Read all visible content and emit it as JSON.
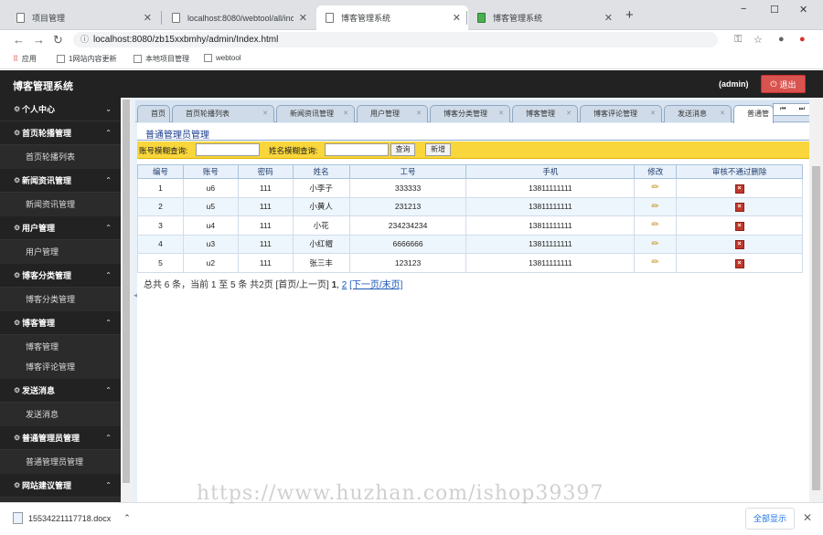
{
  "browser": {
    "tabs": [
      {
        "title": "项目管理",
        "active": false
      },
      {
        "title": "localhost:8080/webtool/all/inc",
        "active": false
      },
      {
        "title": "博客管理系统",
        "active": true
      },
      {
        "title": "博客管理系统",
        "active": false
      }
    ],
    "new_tab": "+",
    "window_controls": [
      "−",
      "☐",
      "✕"
    ],
    "url": "localhost:8080/zb15xxbmhy/admin/Index.html",
    "bookmarks": [
      "应用",
      "1网站内容更新",
      "本地项目管理",
      "webtool"
    ]
  },
  "app": {
    "title": "博客管理系统",
    "user": "(admin)",
    "logout_label": "退出",
    "accent": "#d9534f"
  },
  "sidebar": {
    "sections": [
      {
        "label": "个人中心",
        "items": [],
        "chevron": "⌄"
      },
      {
        "label": "首页轮播管理",
        "items": [
          "首页轮播列表"
        ],
        "chevron": "⌃"
      },
      {
        "label": "新闻资讯管理",
        "items": [
          "新闻资讯管理"
        ],
        "chevron": "⌃"
      },
      {
        "label": "用户管理",
        "items": [
          "用户管理"
        ],
        "chevron": "⌃"
      },
      {
        "label": "博客分类管理",
        "items": [
          "博客分类管理"
        ],
        "chevron": "⌃"
      },
      {
        "label": "博客管理",
        "items": [
          "博客管理",
          "博客评论管理"
        ],
        "chevron": "⌃"
      },
      {
        "label": "发送消息",
        "items": [
          "发送消息"
        ],
        "chevron": "⌃"
      },
      {
        "label": "普通管理员管理",
        "items": [
          "普通管理员管理"
        ],
        "chevron": "⌃"
      },
      {
        "label": "网站建议管理",
        "items": [],
        "chevron": "⌃"
      }
    ]
  },
  "page_tabs": [
    {
      "label": "首页",
      "active": false
    },
    {
      "label": "首页轮播列表",
      "active": false
    },
    {
      "label": "新闻资讯管理",
      "active": false
    },
    {
      "label": "用户管理",
      "active": false
    },
    {
      "label": "博客分类管理",
      "active": false
    },
    {
      "label": "博客管理",
      "active": false
    },
    {
      "label": "博客评论管理",
      "active": false
    },
    {
      "label": "发送消息",
      "active": false
    },
    {
      "label": "普通管",
      "active": true
    }
  ],
  "main": {
    "heading": "普通管理员管理",
    "search": {
      "account_label": "账号模糊查询:",
      "name_label": "姓名模糊查询:",
      "search_btn": "查询",
      "new_btn": "新增"
    },
    "table": {
      "headers": [
        "编号",
        "账号",
        "密码",
        "姓名",
        "工号",
        "手机",
        "修改",
        "审核不通过删除"
      ],
      "rows": [
        [
          "1",
          "u6",
          "111",
          "小李子",
          "333333",
          "13811111111"
        ],
        [
          "2",
          "u5",
          "111",
          "小黄人",
          "231213",
          "13811111111"
        ],
        [
          "3",
          "u4",
          "111",
          "小花",
          "234234234",
          "13811111111"
        ],
        [
          "4",
          "u3",
          "111",
          "小红帽",
          "6666666",
          "13811111111"
        ],
        [
          "5",
          "u2",
          "111",
          "张三丰",
          "123123",
          "13811111111"
        ]
      ]
    },
    "pager": {
      "summary": "总共 6 条，当前 1 至 5 条 共2页",
      "first_prev": "[首页/上一页]",
      "page1": "1",
      "page2": "2",
      "next_last": "[下一页/末页]"
    }
  },
  "download": {
    "filename": "15534221117718.docx",
    "show_all": "全部显示"
  },
  "watermark": "https://www.huzhan.com/ishop39397"
}
